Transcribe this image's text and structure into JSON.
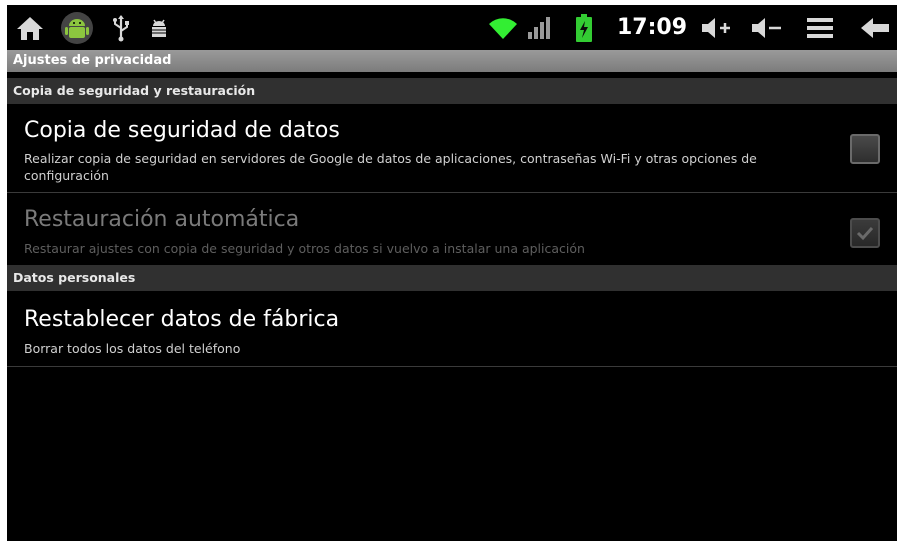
{
  "statusbar": {
    "time": "17:09",
    "icons_left": [
      "home-icon",
      "android-icon",
      "usb-icon",
      "debug-icon"
    ],
    "icons_right": [
      "wifi-icon",
      "signal-icon",
      "battery-icon",
      "volume-up-icon",
      "volume-down-icon",
      "menu-icon",
      "back-icon"
    ],
    "colors": {
      "wifi": "#33ee33",
      "battery": "#33cc33"
    }
  },
  "title": "Ajustes de privacidad",
  "sections": [
    {
      "header": "Copia de seguridad y restauración",
      "items": [
        {
          "title": "Copia de seguridad de datos",
          "summary": "Realizar copia de seguridad en servidores de Google de datos de aplicaciones, contraseñas Wi-Fi y otras opciones de configuración",
          "checked": false,
          "enabled": true
        },
        {
          "title": "Restauración automática",
          "summary": "Restaurar ajustes con copia de seguridad y otros datos si vuelvo a instalar una aplicación",
          "checked": true,
          "enabled": false
        }
      ]
    },
    {
      "header": "Datos personales",
      "items": [
        {
          "title": "Restablecer datos de fábrica",
          "summary": "Borrar todos los datos del teléfono"
        }
      ]
    }
  ]
}
